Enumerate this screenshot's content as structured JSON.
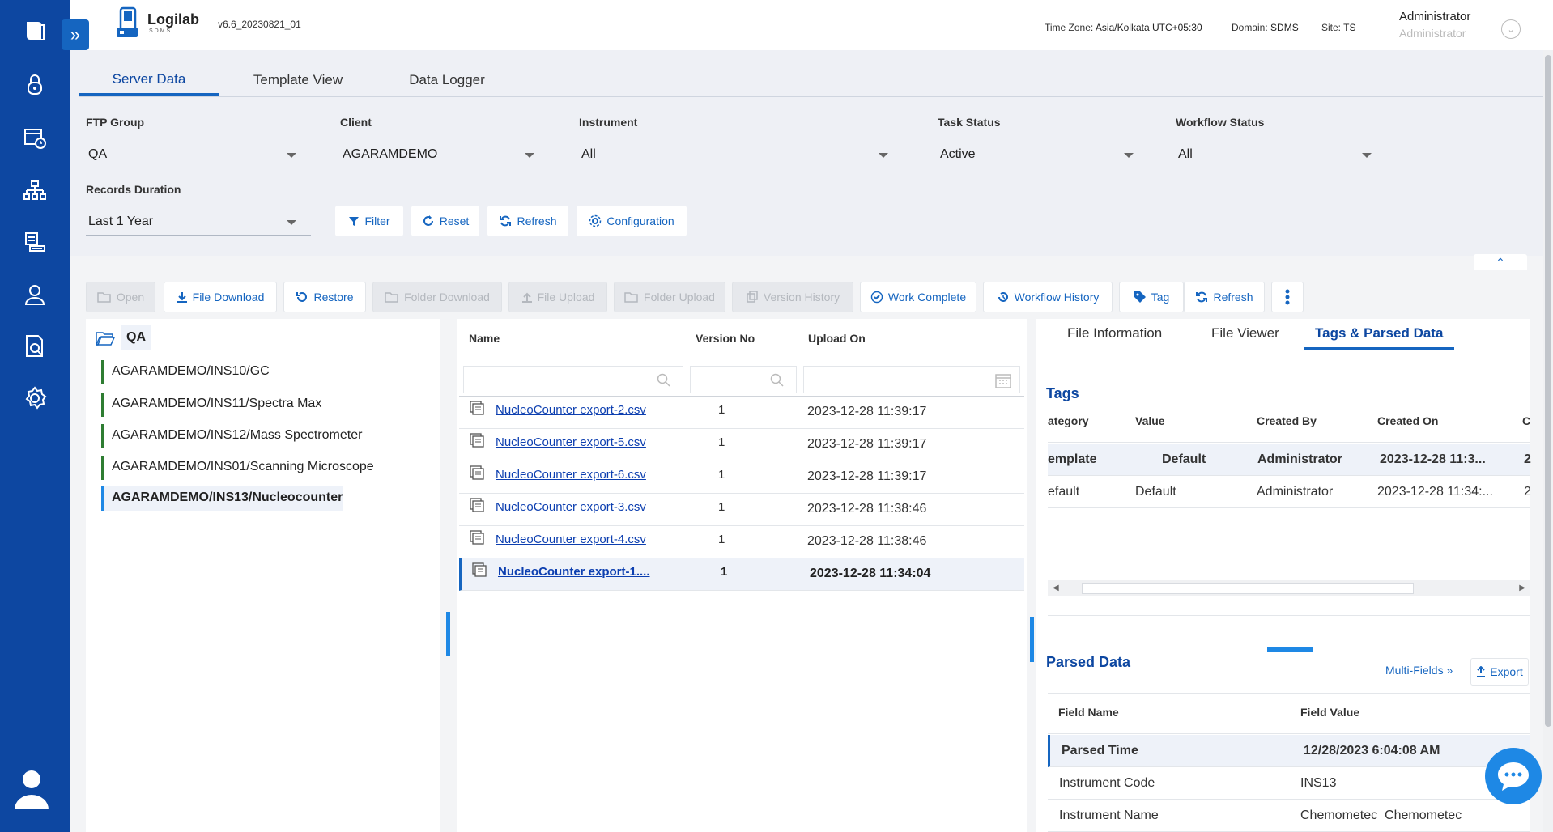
{
  "app": {
    "name": "Logilab",
    "subtitle": "SDMS",
    "version": "v6.6_20230821_01"
  },
  "header": {
    "timezone_label": "Time Zone:",
    "timezone_value": "Asia/Kolkata UTC+05:30",
    "domain_label": "Domain:",
    "domain_value": "SDMS",
    "site_label": "Site:",
    "site_value": "TS",
    "user_name": "Administrator",
    "user_role": "Administrator"
  },
  "nav_icons": [
    "book-icon",
    "lock-icon",
    "calendar-clock-icon",
    "hierarchy-icon",
    "report-icon",
    "user-icon",
    "document-search-icon",
    "settings-icon",
    "account-icon"
  ],
  "tabs": [
    "Server Data",
    "Template View",
    "Data Logger"
  ],
  "filters": {
    "ftp_group": {
      "label": "FTP Group",
      "value": "QA"
    },
    "client": {
      "label": "Client",
      "value": "AGARAMDEMO"
    },
    "instrument": {
      "label": "Instrument",
      "value": "All"
    },
    "task_status": {
      "label": "Task Status",
      "value": "Active"
    },
    "workflow_status": {
      "label": "Workflow Status",
      "value": "All"
    },
    "records_duration": {
      "label": "Records Duration",
      "value": "Last 1 Year"
    },
    "buttons": {
      "filter": "Filter",
      "reset": "Reset",
      "refresh": "Refresh",
      "configuration": "Configuration"
    }
  },
  "toolbar": {
    "open": "Open",
    "file_download": "File Download",
    "restore": "Restore",
    "folder_download": "Folder Download",
    "file_upload": "File Upload",
    "folder_upload": "Folder Upload",
    "version_history": "Version History",
    "work_complete": "Work Complete",
    "workflow_history": "Workflow History",
    "tag": "Tag",
    "refresh": "Refresh"
  },
  "tree": {
    "root": "QA",
    "items": [
      "AGARAMDEMO/INS10/GC",
      "AGARAMDEMO/INS11/Spectra Max",
      "AGARAMDEMO/INS12/Mass Spectrometer",
      "AGARAMDEMO/INS01/Scanning Microscope",
      "AGARAMDEMO/INS13/Nucleocounter"
    ]
  },
  "files": {
    "columns": {
      "name": "Name",
      "version": "Version No",
      "upload": "Upload On"
    },
    "rows": [
      {
        "name": "NucleoCounter export-2.csv",
        "version": "1",
        "date": "2023-12-28 11:39:17"
      },
      {
        "name": "NucleoCounter export-5.csv",
        "version": "1",
        "date": "2023-12-28 11:39:17"
      },
      {
        "name": "NucleoCounter export-6.csv",
        "version": "1",
        "date": "2023-12-28 11:39:17"
      },
      {
        "name": "NucleoCounter export-3.csv",
        "version": "1",
        "date": "2023-12-28 11:38:46"
      },
      {
        "name": "NucleoCounter export-4.csv",
        "version": "1",
        "date": "2023-12-28 11:38:46"
      },
      {
        "name": "NucleoCounter export-1....",
        "version": "1",
        "date": "2023-12-28 11:34:04"
      }
    ]
  },
  "right_tabs": [
    "File Information",
    "File Viewer",
    "Tags & Parsed Data"
  ],
  "tags": {
    "title": "Tags",
    "columns": {
      "category": "ategory",
      "value": "Value",
      "created_by": "Created By",
      "created_on": "Created On",
      "extra": "C"
    },
    "rows": [
      {
        "category": "emplate",
        "value": "Default",
        "created_by": "Administrator",
        "created_on": "2023-12-28 11:3...",
        "extra": "2"
      },
      {
        "category": "efault",
        "value": "Default",
        "created_by": "Administrator",
        "created_on": "2023-12-28 11:34:...",
        "extra": "2"
      }
    ]
  },
  "parsed": {
    "title": "Parsed Data",
    "multi_fields": "Multi-Fields",
    "export": "Export",
    "columns": {
      "field_name": "Field Name",
      "field_value": "Field Value"
    },
    "rows": [
      {
        "name": "Parsed Time",
        "value": "12/28/2023 6:04:08 AM"
      },
      {
        "name": "Instrument Code",
        "value": "INS13"
      },
      {
        "name": "Instrument Name",
        "value": "Chemometec_Chemometec"
      }
    ]
  },
  "colors": {
    "nav": "#0d47a1",
    "accent": "#1565c0",
    "link": "#0d3fb0"
  }
}
